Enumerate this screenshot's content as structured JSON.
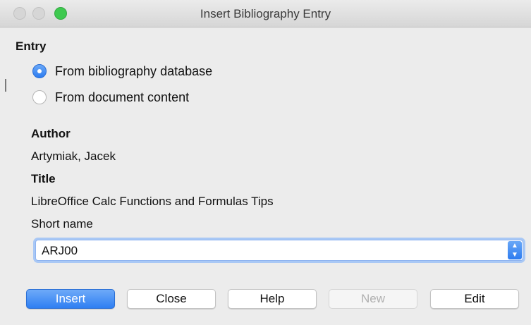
{
  "window": {
    "title": "Insert Bibliography Entry"
  },
  "entry": {
    "section_label": "Entry",
    "options": [
      {
        "label": "From bibliography database",
        "selected": true
      },
      {
        "label": "From document content",
        "selected": false
      }
    ]
  },
  "fields": {
    "author_label": "Author",
    "author_value": "Artymiak, Jacek",
    "title_label": "Title",
    "title_value": "LibreOffice Calc Functions and Formulas Tips",
    "short_name_label": "Short name",
    "short_name_value": "ARJ00"
  },
  "buttons": {
    "insert": "Insert",
    "close": "Close",
    "help": "Help",
    "new": "New",
    "edit": "Edit"
  },
  "colors": {
    "accent": "#2f7ff2",
    "zoom_button": "#3fc950"
  },
  "icons": {
    "combo_arrow": "updown-chevron-icon"
  }
}
